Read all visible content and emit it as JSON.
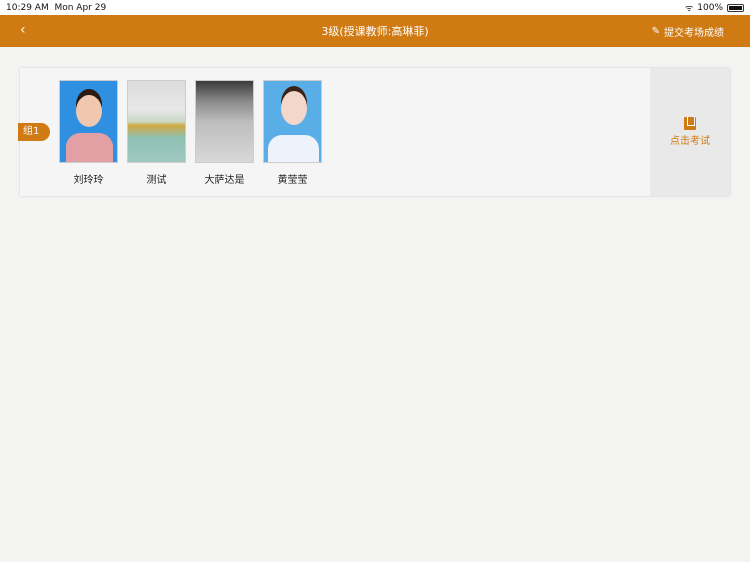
{
  "status": {
    "time": "10:29 AM",
    "date": "Mon Apr 29",
    "battery": "100%"
  },
  "nav": {
    "back": "‹",
    "title": "3级(授课教师:高琳菲)",
    "submit": "提交考场成绩"
  },
  "group": {
    "label": "组1",
    "students": [
      {
        "name": "刘玲玲"
      },
      {
        "name": "测试"
      },
      {
        "name": "大萨达是"
      },
      {
        "name": "黄莹莹"
      }
    ]
  },
  "exam": {
    "label": "点击考试"
  },
  "colors": {
    "accent": "#cf7a12"
  }
}
